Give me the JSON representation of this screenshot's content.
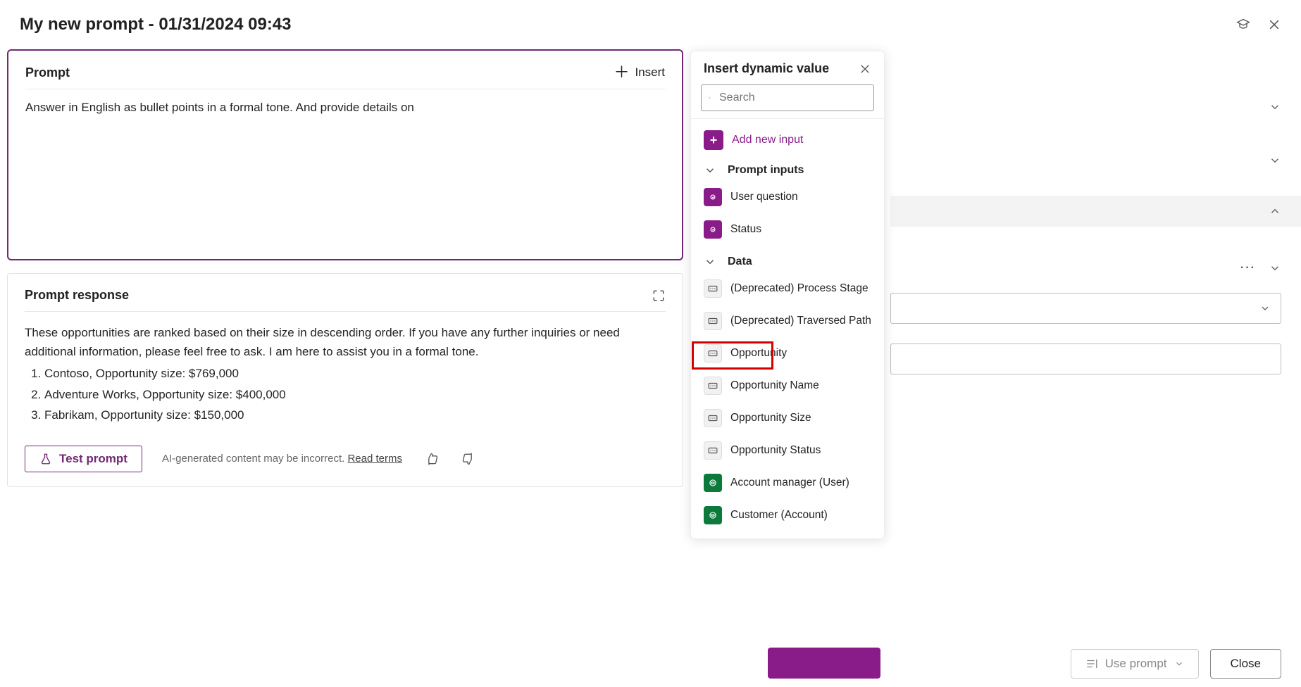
{
  "header": {
    "title": "My new prompt - 01/31/2024 09:43"
  },
  "prompt": {
    "title": "Prompt",
    "insert_label": "Insert",
    "text": "Answer in English as bullet points in a formal tone. And provide details on"
  },
  "response": {
    "title": "Prompt response",
    "intro": "These opportunities are ranked based on their size in descending order. If you have any further inquiries or need additional information, please feel free to ask. I am here to assist you in a formal tone.",
    "items": [
      "Contoso, Opportunity size: $769,000",
      "Adventure Works, Opportunity size: $400,000",
      "Fabrikam, Opportunity size: $150,000"
    ],
    "test_label": "Test prompt",
    "ai_note": "AI-generated content may be incorrect.",
    "read_terms": "Read terms"
  },
  "panel": {
    "title": "Insert dynamic value",
    "search_placeholder": "Search",
    "add_input": "Add new input",
    "prompt_inputs_header": "Prompt inputs",
    "prompt_inputs": [
      "User question",
      "Status"
    ],
    "data_header": "Data",
    "data_items": [
      {
        "label": "(Deprecated) Process Stage",
        "chip": "grey"
      },
      {
        "label": "(Deprecated) Traversed Path",
        "chip": "grey"
      },
      {
        "label": "Opportunity",
        "chip": "grey"
      },
      {
        "label": "Opportunity Name",
        "chip": "grey"
      },
      {
        "label": "Opportunity Size",
        "chip": "grey"
      },
      {
        "label": "Opportunity Status",
        "chip": "grey"
      },
      {
        "label": "Account manager (User)",
        "chip": "green"
      },
      {
        "label": "Customer (Account)",
        "chip": "green"
      }
    ]
  },
  "footer": {
    "use_prompt": "Use prompt",
    "close": "Close"
  }
}
